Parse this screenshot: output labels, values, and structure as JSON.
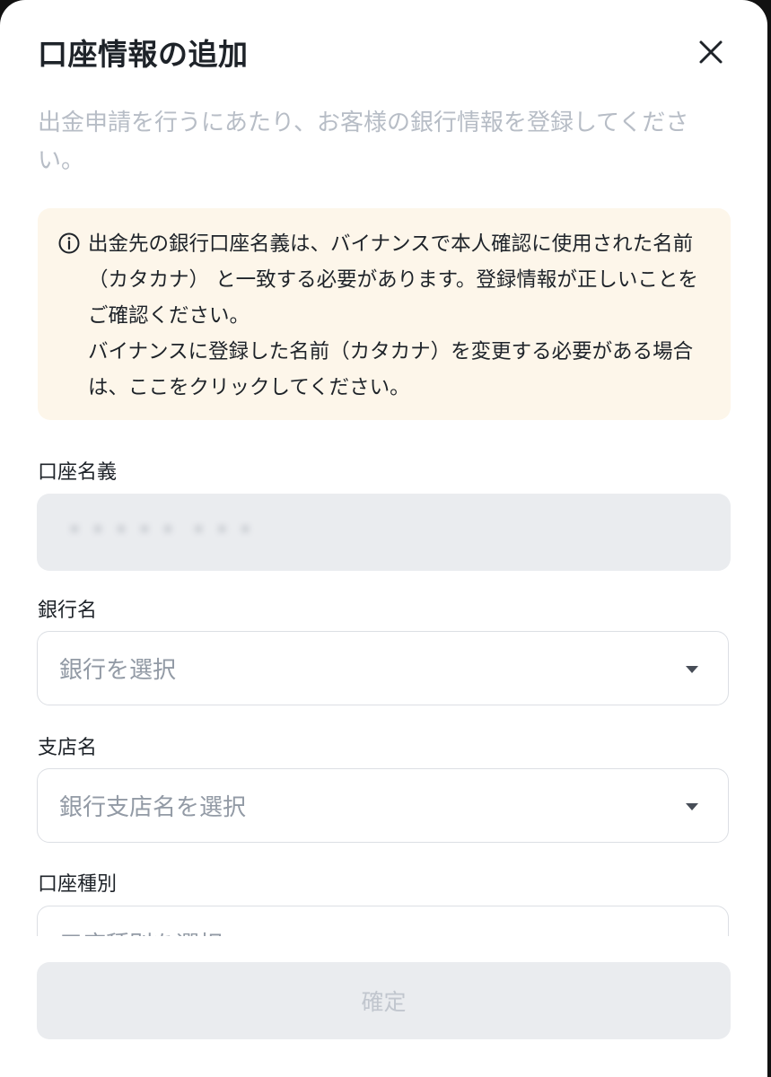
{
  "modal": {
    "title": "口座情報の追加",
    "subtitle": "出金申請を行うにあたり、お客様の銀行情報を登録してください。",
    "notice": {
      "icon": "info-icon",
      "line1": "出金先の銀行口座名義は、バイナンスで本人確認に使用された名前（カタカナ） と一致する必要があります。登録情報が正しいことをご確認ください。",
      "line2": "バイナンスに登録した名前（カタカナ）を変更する必要がある場合は、ここをクリックしてください。"
    }
  },
  "form": {
    "account_holder": {
      "label": "口座名義",
      "value": "・・・・・ ・・・"
    },
    "bank_name": {
      "label": "銀行名",
      "placeholder": "銀行を選択"
    },
    "branch_name": {
      "label": "支店名",
      "placeholder": "銀行支店名を選択"
    },
    "account_type": {
      "label": "口座種別",
      "placeholder": "口座種別を選択"
    }
  },
  "footer": {
    "confirm_label": "確定"
  },
  "colors": {
    "notice_bg": "#fdf6ea",
    "disabled_bg": "#eaecef",
    "primary_text": "#1e2329",
    "muted_text": "#b7bdc6"
  }
}
